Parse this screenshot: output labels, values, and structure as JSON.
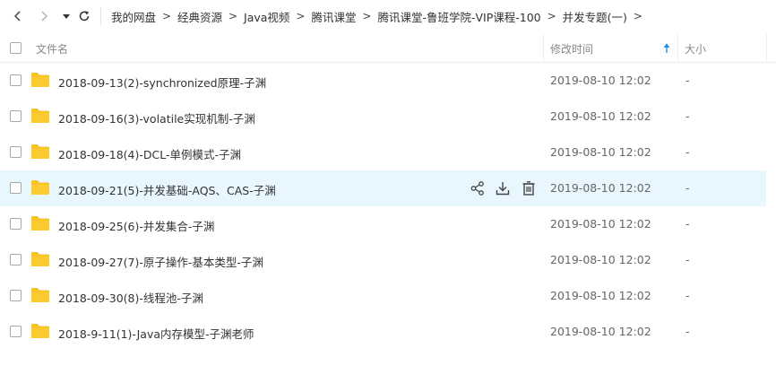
{
  "breadcrumb": [
    "我的网盘",
    "经典资源",
    "Java视频",
    "腾讯课堂",
    "腾讯课堂-鲁班学院-VIP课程-100",
    "并发专题(一)"
  ],
  "breadcrumb_sep": ">",
  "columns": {
    "name": "文件名",
    "modified": "修改时间",
    "size": "大小"
  },
  "files": [
    {
      "name": "2018-09-13(2)-synchronized原理-子渊",
      "modified": "2019-08-10 12:02",
      "size": "-"
    },
    {
      "name": "2018-09-16(3)-volatile实现机制-子渊",
      "modified": "2019-08-10 12:02",
      "size": "-"
    },
    {
      "name": "2018-09-18(4)-DCL-单例模式-子渊",
      "modified": "2019-08-10 12:02",
      "size": "-"
    },
    {
      "name": "2018-09-21(5)-并发基础-AQS、CAS-子渊",
      "modified": "2019-08-10 12:02",
      "size": "-"
    },
    {
      "name": "2018-09-25(6)-并发集合-子渊",
      "modified": "2019-08-10 12:02",
      "size": "-"
    },
    {
      "name": "2018-09-27(7)-原子操作-基本类型-子渊",
      "modified": "2019-08-10 12:02",
      "size": "-"
    },
    {
      "name": "2018-09-30(8)-线程池-子渊",
      "modified": "2019-08-10 12:02",
      "size": "-"
    },
    {
      "name": "2018-9-11(1)-Java内存模型-子渊老师",
      "modified": "2019-08-10 12:02",
      "size": "-"
    }
  ],
  "hovered_row": 3,
  "icons": {
    "back": "chevron-left-icon",
    "forward": "chevron-right-icon",
    "history": "caret-down-icon",
    "refresh": "refresh-icon",
    "folder": "folder-icon",
    "share": "share-icon",
    "download": "download-icon",
    "delete": "trash-icon",
    "sort": "sort-ascending-icon"
  },
  "colors": {
    "folder": "#F7C325",
    "hover_row": "#E8F6FD",
    "sort_accent": "#1E90E6"
  }
}
